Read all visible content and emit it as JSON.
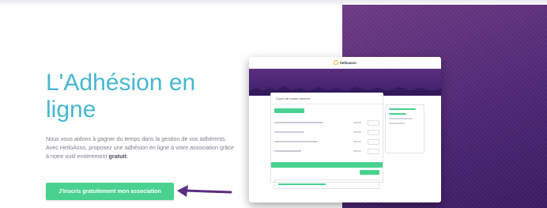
{
  "hero": {
    "title": "L'Adhésion en ligne",
    "description_prefix": "Nous vous aidons à gagner du temps dans la gestion de vos adhérents. Avec HelloAsso, proposez une adhésion en ligne à votre association grâce à notre outil entièrement ",
    "description_bold": "gratuit",
    "description_suffix": ".",
    "cta_label": "J'inscris gratuitement mon association"
  },
  "mockup": {
    "brand": "helloasso",
    "form_title": "Cours de bonne humeur"
  },
  "colors": {
    "title": "#47b7cf",
    "cta": "#49d28f",
    "purple_panel": "#4f2776",
    "arrow": "#5a2d82",
    "brand_mark": "#f3b425"
  },
  "icons": {
    "arrow": "arrow-left-icon",
    "logo": "helloasso-logo-icon"
  }
}
